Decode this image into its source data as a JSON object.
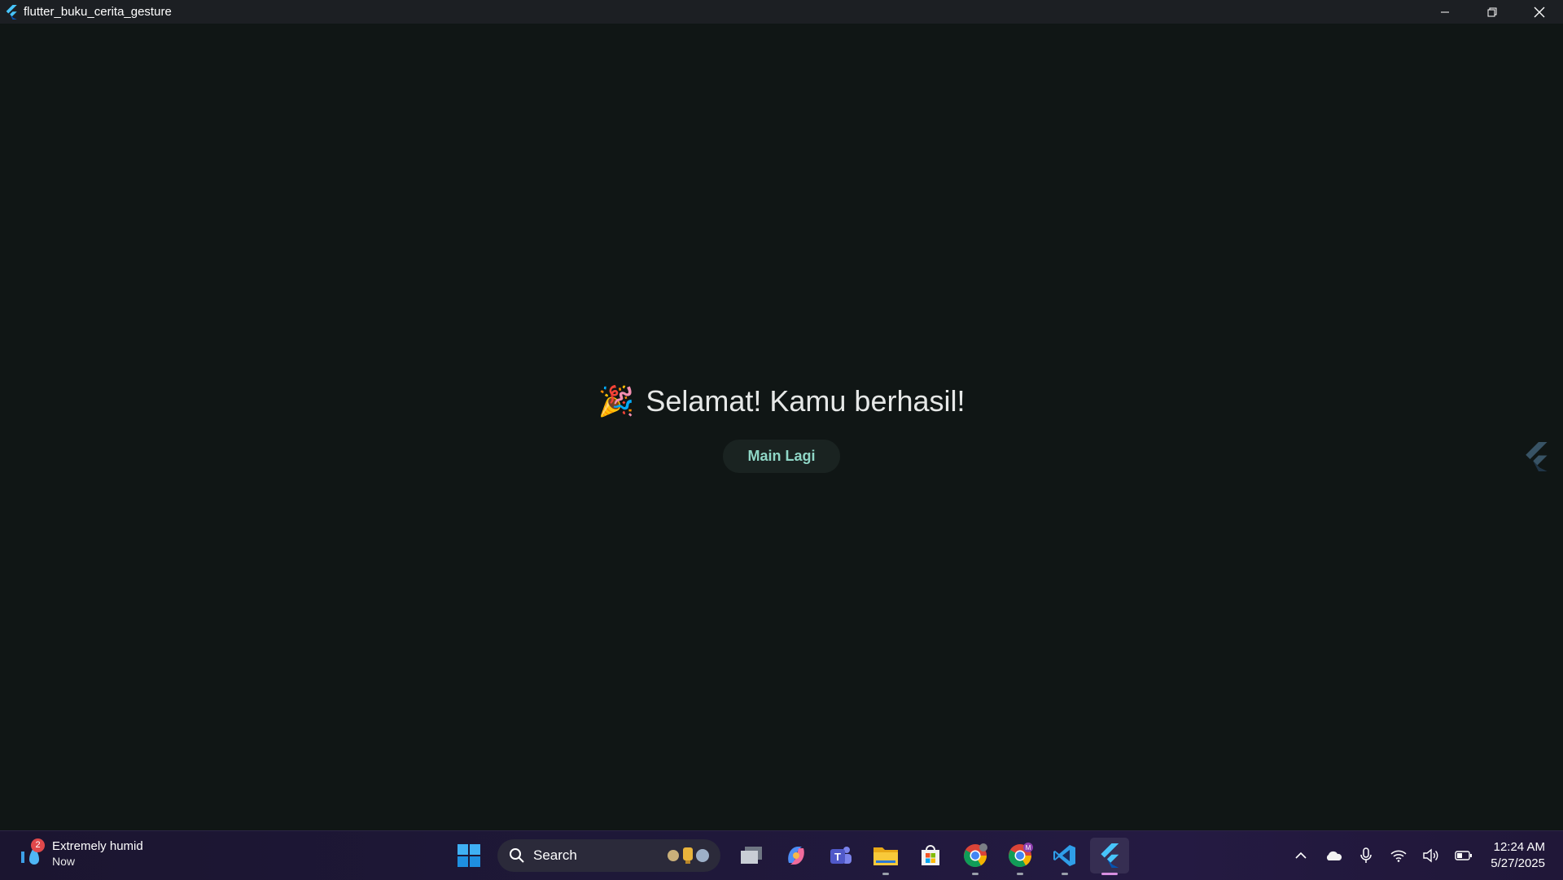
{
  "window": {
    "title": "flutter_buku_cerita_gesture",
    "controls": [
      "minimize",
      "restore",
      "close"
    ]
  },
  "app": {
    "emoji": "🎉",
    "message": "Selamat! Kamu berhasil!",
    "button_label": "Main Lagi",
    "colors": {
      "background": "#101615",
      "button_text": "#8fd6c6",
      "button_bg": "#1a2321"
    }
  },
  "taskbar": {
    "weather": {
      "badge_count": "2",
      "title": "Extremely humid",
      "subtitle": "Now"
    },
    "search": {
      "placeholder": "Search"
    },
    "pinned_apps": [
      "start-icon",
      "task-view-icon",
      "copilot-icon",
      "teams-icon",
      "file-explorer-icon",
      "microsoft-store-icon",
      "chrome-icon",
      "chrome-profile-icon",
      "vscode-icon",
      "flutter-app-icon"
    ],
    "tray_icons": [
      "chevron-up-icon",
      "onedrive-icon",
      "microphone-icon",
      "wifi-icon",
      "volume-icon",
      "battery-icon"
    ],
    "clock": {
      "time": "12:24 AM",
      "date": "5/27/2025"
    }
  }
}
